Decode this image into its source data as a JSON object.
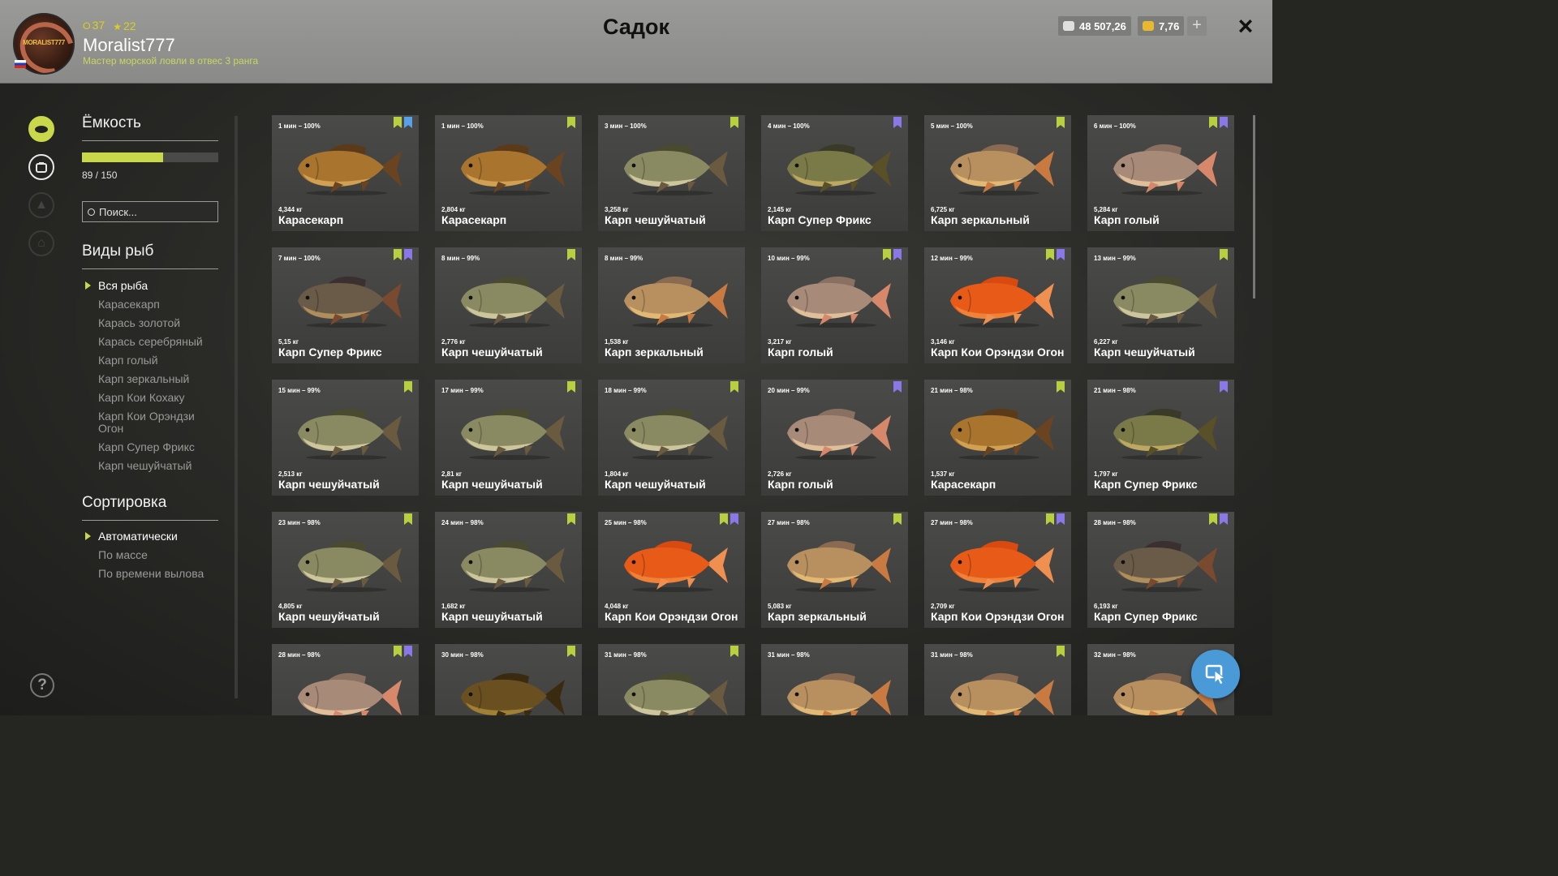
{
  "header": {
    "title": "Садок",
    "username": "Moralist777",
    "rank_text": "Мастер морской ловли в отвес 3 ранга",
    "level": "37",
    "stars": "22",
    "avatar_text": "MORALIST777",
    "silver": "48 507,26",
    "gold": "7,76",
    "add_label": "+",
    "close_label": "×"
  },
  "sidebar": {
    "capacity_title": "Ёмкость",
    "capacity_text": "89 / 150",
    "capacity_fraction": 0.593,
    "search_placeholder": "Поиск...",
    "species_title": "Виды рыб",
    "species": [
      "Вся рыба",
      "Карасекарп",
      "Карась золотой",
      "Карась серебряный",
      "Карп голый",
      "Карп зеркальный",
      "Карп Кои Кохаку",
      "Карп Кои Орэндзи Огон",
      "Карп Супер Фрикс",
      "Карп чешуйчатый"
    ],
    "sort_title": "Сортировка",
    "sort_options": [
      "Автоматически",
      "По массе",
      "По времени вылова"
    ],
    "help_label": "?"
  },
  "colors": {
    "accent": "#c8d84a",
    "mark_green": "#b8d040",
    "mark_purple": "#8a78e8",
    "fab": "#4a9ad8"
  },
  "fish": [
    {
      "time": "1 мин – 100%",
      "weight": "4,344 кг",
      "name": "Карасекарп",
      "marks": "gb",
      "kind": "crucian"
    },
    {
      "time": "1 мин – 100%",
      "weight": "2,804 кг",
      "name": "Карасекарп",
      "marks": "g",
      "kind": "crucian"
    },
    {
      "time": "3 мин – 100%",
      "weight": "3,258 кг",
      "name": "Карп чешуйчатый",
      "marks": "g",
      "kind": "common"
    },
    {
      "time": "4 мин – 100%",
      "weight": "2,145 кг",
      "name": "Карп Супер Фрикс",
      "marks": "p",
      "kind": "freaks"
    },
    {
      "time": "5 мин – 100%",
      "weight": "6,725 кг",
      "name": "Карп зеркальный",
      "marks": "g",
      "kind": "mirror"
    },
    {
      "time": "6 мин – 100%",
      "weight": "5,284 кг",
      "name": "Карп голый",
      "marks": "gp",
      "kind": "leather"
    },
    {
      "time": "7 мин – 100%",
      "weight": "5,15 кг",
      "name": "Карп Супер Фрикс",
      "marks": "gp",
      "kind": "freaks2"
    },
    {
      "time": "8 мин – 99%",
      "weight": "2,776 кг",
      "name": "Карп чешуйчатый",
      "marks": "g",
      "kind": "common"
    },
    {
      "time": "8 мин – 99%",
      "weight": "1,538 кг",
      "name": "Карп зеркальный",
      "marks": "",
      "kind": "mirror"
    },
    {
      "time": "10 мин – 99%",
      "weight": "3,217 кг",
      "name": "Карп голый",
      "marks": "gp",
      "kind": "leather"
    },
    {
      "time": "12 мин – 99%",
      "weight": "3,146 кг",
      "name": "Карп Кои Орэндзи Огон",
      "marks": "gp",
      "kind": "koi"
    },
    {
      "time": "13 мин – 99%",
      "weight": "6,227 кг",
      "name": "Карп чешуйчатый",
      "marks": "g",
      "kind": "common"
    },
    {
      "time": "15 мин – 99%",
      "weight": "2,513 кг",
      "name": "Карп чешуйчатый",
      "marks": "g",
      "kind": "common"
    },
    {
      "time": "17 мин – 99%",
      "weight": "2,81 кг",
      "name": "Карп чешуйчатый",
      "marks": "g",
      "kind": "common"
    },
    {
      "time": "18 мин – 99%",
      "weight": "1,804 кг",
      "name": "Карп чешуйчатый",
      "marks": "g",
      "kind": "common"
    },
    {
      "time": "20 мин – 99%",
      "weight": "2,726 кг",
      "name": "Карп голый",
      "marks": "p",
      "kind": "leather"
    },
    {
      "time": "21 мин – 98%",
      "weight": "1,537 кг",
      "name": "Карасекарп",
      "marks": "g",
      "kind": "crucian"
    },
    {
      "time": "21 мин – 98%",
      "weight": "1,797 кг",
      "name": "Карп Супер Фрикс",
      "marks": "p",
      "kind": "freaks"
    },
    {
      "time": "23 мин – 98%",
      "weight": "4,805 кг",
      "name": "Карп чешуйчатый",
      "marks": "g",
      "kind": "common"
    },
    {
      "time": "24 мин – 98%",
      "weight": "1,682 кг",
      "name": "Карп чешуйчатый",
      "marks": "g",
      "kind": "common"
    },
    {
      "time": "25 мин – 98%",
      "weight": "4,048 кг",
      "name": "Карп Кои Орэндзи Огон",
      "marks": "gp",
      "kind": "koi"
    },
    {
      "time": "27 мин – 98%",
      "weight": "5,083 кг",
      "name": "Карп зеркальный",
      "marks": "g",
      "kind": "mirror"
    },
    {
      "time": "27 мин – 98%",
      "weight": "2,709 кг",
      "name": "Карп Кои Орэндзи Огон",
      "marks": "gp",
      "kind": "koi"
    },
    {
      "time": "28 мин – 98%",
      "weight": "6,193 кг",
      "name": "Карп Супер Фрикс",
      "marks": "gp",
      "kind": "freaks2"
    },
    {
      "time": "28 мин – 98%",
      "weight": "",
      "name": "",
      "marks": "gp",
      "kind": "leather"
    },
    {
      "time": "30 мин – 98%",
      "weight": "",
      "name": "",
      "marks": "g",
      "kind": "crucian2"
    },
    {
      "time": "31 мин – 98%",
      "weight": "",
      "name": "",
      "marks": "g",
      "kind": "common"
    },
    {
      "time": "31 мин – 98%",
      "weight": "",
      "name": "",
      "marks": "",
      "kind": "mirror"
    },
    {
      "time": "31 мин – 98%",
      "weight": "",
      "name": "",
      "marks": "g",
      "kind": "mirror"
    },
    {
      "time": "32 мин – 98%",
      "weight": "",
      "name": "",
      "marks": "",
      "kind": "mirror"
    }
  ]
}
